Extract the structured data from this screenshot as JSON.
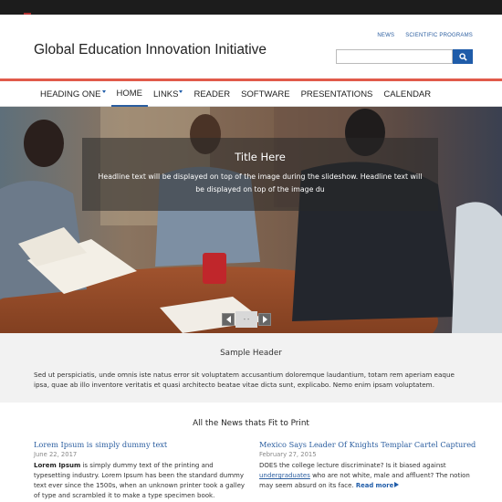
{
  "site": {
    "title": "Global Education Innovation Initiative"
  },
  "utility": {
    "news": "NEWS",
    "scientific_programs": "SCIENTIFIC PROGRAMS"
  },
  "search": {
    "placeholder": "",
    "button_icon": "search-icon"
  },
  "colors": {
    "accent": "#1f5ca9",
    "redline": "#e15a4a",
    "topbar": "#1c1c1c"
  },
  "nav": {
    "items": [
      {
        "label": "HEADING ONE",
        "dropdown": true,
        "active": false
      },
      {
        "label": "HOME",
        "dropdown": false,
        "active": true
      },
      {
        "label": "LINKS",
        "dropdown": true,
        "active": false
      },
      {
        "label": "READER",
        "dropdown": false,
        "active": false
      },
      {
        "label": "SOFTWARE",
        "dropdown": false,
        "active": false
      },
      {
        "label": "PRESENTATIONS",
        "dropdown": false,
        "active": false
      },
      {
        "label": "CALENDAR",
        "dropdown": false,
        "active": false
      }
    ]
  },
  "hero": {
    "title": "Title Here",
    "text": "Headline text will be displayed on top of the image during the slideshow. Headline text will be displayed on top of the image du",
    "prev_icon": "chevron-left-icon",
    "next_icon": "chevron-right-icon",
    "pager": "- -"
  },
  "sample": {
    "header": "Sample Header",
    "text": "Sed ut perspiciatis, unde omnis iste natus error sit voluptatem accusantium doloremque laudantium, totam rem aperiam eaque ipsa, quae ab illo inventore veritatis et quasi architecto beatae vitae dicta sunt, explicabo. Nemo enim ipsam voluptatem."
  },
  "news": {
    "section_title": "All the News thats Fit to Print",
    "items": [
      {
        "headline": "Lorem Ipsum is simply dummy text",
        "date": "June 22, 2017",
        "lead": "Lorem Ipsum",
        "body": " is simply dummy text of the printing and typesetting industry. Lorem Ipsum has been the standard dummy text ever since the 1500s, when an unknown printer took a galley of type and scrambled it to make a type specimen book."
      },
      {
        "headline": "Mexico Says Leader Of Knights Templar Cartel Captured",
        "date": "February 27, 2015",
        "body_before": "DOES the college lecture discriminate? Is it biased against ",
        "link": "undergraduates",
        "body_after": " who are not white, male and affluent? The notion may seem absurd on its face. ",
        "read_more": "Read more"
      }
    ]
  }
}
